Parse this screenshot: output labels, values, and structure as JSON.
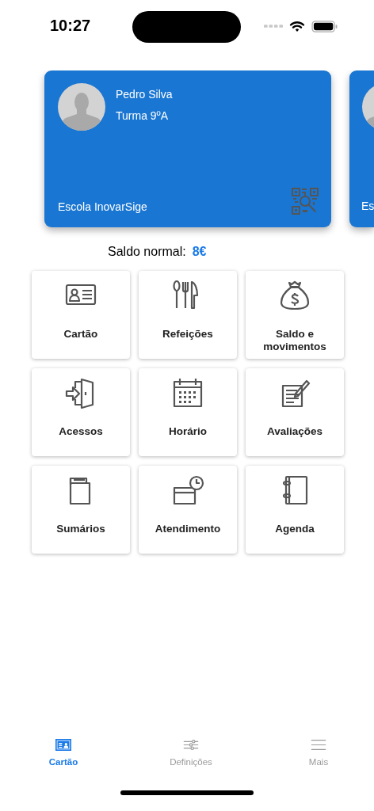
{
  "status_bar": {
    "time": "10:27"
  },
  "cards": [
    {
      "name": "Pedro Silva",
      "class": "Turma 9ºA",
      "school": "Escola InovarSige"
    },
    {
      "school": "Es"
    }
  ],
  "balance": {
    "label": "Saldo normal:",
    "value": "8€"
  },
  "tiles": [
    {
      "label": "Cartão"
    },
    {
      "label": "Refeições"
    },
    {
      "label": "Saldo e movimentos"
    },
    {
      "label": "Acessos"
    },
    {
      "label": "Horário"
    },
    {
      "label": "Avaliações"
    },
    {
      "label": "Sumários"
    },
    {
      "label": "Atendimento"
    },
    {
      "label": "Agenda"
    }
  ],
  "tabs": [
    {
      "label": "Cartão",
      "selected": true
    },
    {
      "label": "Definições",
      "selected": false
    },
    {
      "label": "Mais",
      "selected": false
    }
  ]
}
